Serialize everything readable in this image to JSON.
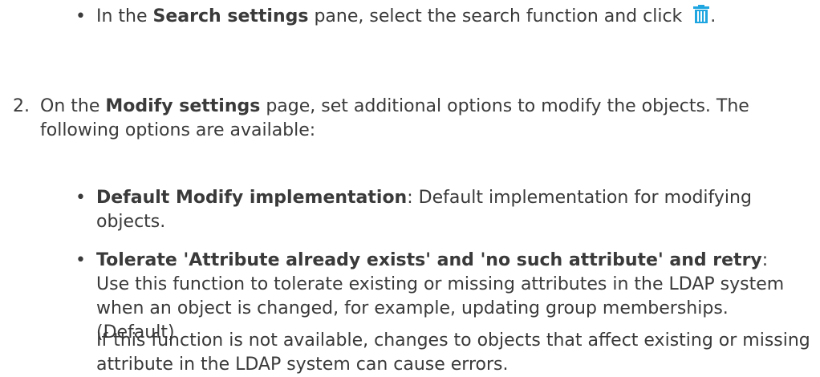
{
  "bullet_search": {
    "bullet": "•",
    "t1": "In the ",
    "bold": "Search settings",
    "t2": " pane, select the search function and click",
    "t3": ".",
    "icon": "trash-icon",
    "icon_color": "#1fa6e0"
  },
  "step2": {
    "number": "2.",
    "t1": "On the ",
    "bold": "Modify settings",
    "t2": " page, set additional options to modify the objects. The following options are available:"
  },
  "option_default": {
    "bullet": "•",
    "bold": "Default Modify implementation",
    "text": ": Default implementation for modifying objects."
  },
  "option_tolerate": {
    "bullet": "•",
    "bold": "Tolerate 'Attribute already exists' and 'no such attribute' and retry",
    "text": ": Use this function to tolerate existing or missing attributes in the LDAP system when an object is changed, for example, updating group memberships. (Default)"
  },
  "note": {
    "text": "If this function is not available, changes to objects that affect existing or missing attribute in the LDAP system can cause errors."
  }
}
